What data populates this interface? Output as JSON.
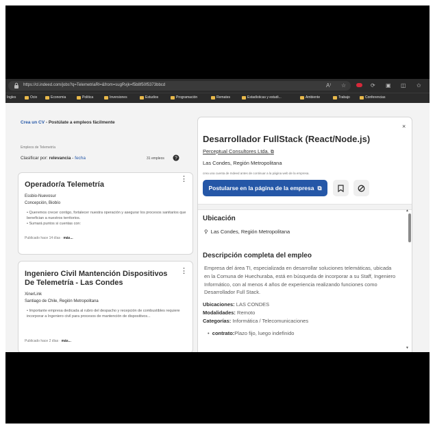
{
  "browser": {
    "url": "https://cl.indeed.com/jobs?q=TelemetriaRl=&from=sugRvjk=f5b8f50f5373bbcd",
    "bookmarks": [
      "Ingles",
      "Ocio",
      "Economia",
      "Politica",
      "Inversiones",
      "Estudios",
      "Programación",
      "Remates",
      "Estadísticas y estudi...",
      "Ambiente",
      "Trabajo",
      "Conferencias"
    ]
  },
  "left": {
    "cv_link": "Crea un CV",
    "cv_text": " - Postúlate a empleos fácilmente",
    "search_label": "Empleos de Telemetría",
    "sort_prefix": "Clasificar por: ",
    "sort_active": "relevancia",
    "sort_sep": " - ",
    "sort_other": "fecha",
    "job_count": "31 empleos"
  },
  "jobs": [
    {
      "title": "Operador/a Telemetría",
      "company": "Essbio-Nuevosur",
      "location": "Concepción, Biobío",
      "bullets": [
        "Queremos crecer contigo, fortalecer nuestra operación y asegurar los procesos sanitarios que benefician a nuestros territorios.",
        "Sumará puntos si cuentas con:"
      ],
      "posted": "Publicado hace 14 días",
      "more": "más..."
    },
    {
      "title": "Ingeniero Civil Mantención Dispositivos De Telemetría - Las Condes",
      "company": "XinerLink",
      "location": "Santiago de Chile, Región Metropolitana",
      "bullets": [
        "Importante empresa dedicada al rubro del despacho y recepción de combustibles requiere incorporar a Ingeniero civil para procesos de mantención de dispositivos..."
      ],
      "posted": "Publicado hace 2 días",
      "more": "más..."
    }
  ],
  "detail": {
    "title": "Desarrollador FullStack (React/Node.js)",
    "company": "Perceptual Consultores Ltda.",
    "location": "Las Condes, Región Metropolitana",
    "note": "crea una cuenta de Indeed antes de continuar a la página web de la empresa.",
    "apply_label": "Postularse en la página de la empresa",
    "location_heading": "Ubicación",
    "location_value": "Las Condes, Región Metropolitana",
    "desc_heading": "Descripción completa del empleo",
    "desc_text": "Empresa del área TI, especializada en desarrollar soluciones telemáticas, ubicada en la Comuna de Huechuraba, está en búsqueda de incorporar a su Staff, Ingeniero Informático, con al menos 4 años de experiencia realizando funciones como Desarrollador Full Stack.",
    "ubicaciones_label": "Ubicaciones:",
    "ubicaciones_value": " LAS CONDES",
    "modalidades_label": "Modalidades:",
    "modalidades_value": " Remoto",
    "categorias_label": "Categorías:",
    "categorias_value": " Informática / Telecomunicaciones",
    "contrato_label": "contrato:",
    "contrato_value": "Plazo fijo, luego indefinido"
  },
  "colors": {
    "accent": "#2557a7",
    "chrome": "#2b2b2b",
    "folder": "#e9b94a"
  }
}
